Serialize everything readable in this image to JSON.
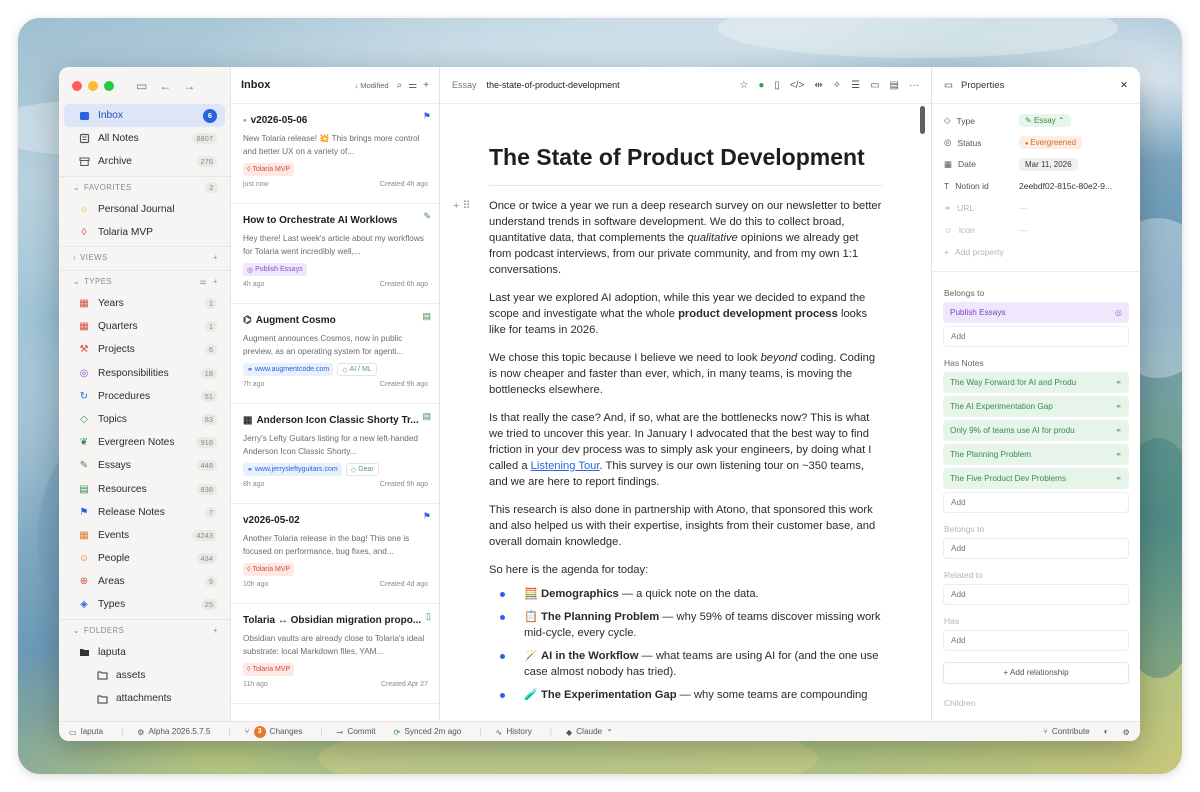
{
  "sidebar": {
    "items": [
      {
        "label": "Inbox",
        "count": "6",
        "icon": "inbox-icon",
        "color": "#2a63e0"
      },
      {
        "label": "All Notes",
        "count": "8807",
        "icon": "notes-icon",
        "color": "#555555"
      },
      {
        "label": "Archive",
        "count": "276",
        "icon": "archive-icon",
        "color": "#555555"
      }
    ],
    "favorites_label": "FAVORITES",
    "favorites_count": "2",
    "favorites": [
      {
        "label": "Personal Journal",
        "icon": "sun-icon",
        "color": "#e8a23a"
      },
      {
        "label": "Tolaria MVP",
        "icon": "drop-icon",
        "color": "#d34c3f"
      }
    ],
    "views_label": "VIEWS",
    "types_label": "TYPES",
    "types": [
      {
        "label": "Years",
        "count": "1",
        "icon": "calendar-icon",
        "color": "#d34c3f"
      },
      {
        "label": "Quarters",
        "count": "1",
        "icon": "calendar-icon",
        "color": "#d34c3f"
      },
      {
        "label": "Projects",
        "count": "6",
        "icon": "wrench-icon",
        "color": "#d34c3f"
      },
      {
        "label": "Responsibilities",
        "count": "18",
        "icon": "target-icon",
        "color": "#8a4fd0"
      },
      {
        "label": "Procedures",
        "count": "51",
        "icon": "cycle-icon",
        "color": "#2a63e0"
      },
      {
        "label": "Topics",
        "count": "83",
        "icon": "tag-icon",
        "color": "#3a8a4f"
      },
      {
        "label": "Evergreen Notes",
        "count": "916",
        "icon": "leaf-icon",
        "color": "#3a8a4f"
      },
      {
        "label": "Essays",
        "count": "448",
        "icon": "pen-icon",
        "color": "#3a8a4f"
      },
      {
        "label": "Resources",
        "count": "838",
        "icon": "book-icon",
        "color": "#3a8a4f"
      },
      {
        "label": "Release Notes",
        "count": "7",
        "icon": "flag-icon",
        "color": "#2a63e0"
      },
      {
        "label": "Events",
        "count": "4243",
        "icon": "calendar-icon",
        "color": "#e8782f"
      },
      {
        "label": "People",
        "count": "434",
        "icon": "people-icon",
        "color": "#e8782f"
      },
      {
        "label": "Areas",
        "count": "9",
        "icon": "globe-icon",
        "color": "#d34c3f"
      },
      {
        "label": "Types",
        "count": "25",
        "icon": "layers-icon",
        "color": "#2a63e0"
      }
    ],
    "folders_label": "FOLDERS",
    "folders": [
      {
        "label": "laputa",
        "icon": "folder-icon"
      },
      {
        "label": "assets",
        "icon": "folder-icon"
      },
      {
        "label": "attachments",
        "icon": "folder-icon"
      }
    ]
  },
  "notelist": {
    "title": "Inbox",
    "sort_label": "Modified",
    "notes": [
      {
        "title": "v2026-05-06",
        "snippet": "New Tolaria release! 💥 This brings more control and better UX on a variety of...",
        "tags": [
          {
            "label": "Tolaria MVP",
            "kind": "red"
          }
        ],
        "left_meta": "just now",
        "right_meta": "Created 4h ago",
        "flag": "⚑",
        "flag_color": "#2a63e0",
        "title_prefix": "●",
        "prefix_color": "#e8782f"
      },
      {
        "title": "How to Orchestrate AI Worklows",
        "snippet": "Hey there! Last week's article about my workflows for Tolaria went incredibly well,...",
        "tags": [
          {
            "label": "Publish Essays",
            "kind": "purple"
          }
        ],
        "left_meta": "4h ago",
        "right_meta": "Created 6h ago",
        "flag": "✎",
        "flag_color": "#3a8a4f",
        "title_prefix": "",
        "prefix_color": "#333333"
      },
      {
        "title": "Augment Cosmo",
        "snippet": "Augment announces Cosmos, now in public preview, as an operating system for agenti...",
        "tags": [
          {
            "label": "www.augmentcode.com",
            "kind": "blue"
          },
          {
            "label": "AI / ML",
            "kind": "gray"
          }
        ],
        "left_meta": "7h ago",
        "right_meta": "Created 9h ago",
        "flag": "▤",
        "flag_color": "#3a8a4f",
        "title_prefix": "⌬",
        "prefix_color": "#333333"
      },
      {
        "title": "Anderson Icon Classic Shorty Tr...",
        "snippet": "Jerry's Lefty Guitars listing for a new left-handed Anderson Icon Classic Shorty...",
        "tags": [
          {
            "label": "www.jerrysleftyguitars.com",
            "kind": "blue"
          },
          {
            "label": "Gear",
            "kind": "gray"
          }
        ],
        "left_meta": "8h ago",
        "right_meta": "Created 9h ago",
        "flag": "▤",
        "flag_color": "#3a8a4f",
        "title_prefix": "▦",
        "prefix_color": "#333333"
      },
      {
        "title": "v2026-05-02",
        "snippet": "Another Tolaria release in the bag! This one is focused on performance, bug fixes, and...",
        "tags": [
          {
            "label": "Tolaria MVP",
            "kind": "red"
          }
        ],
        "left_meta": "10h ago",
        "right_meta": "Created 4d ago",
        "flag": "⚑",
        "flag_color": "#2a63e0",
        "title_prefix": "",
        "prefix_color": "#333333"
      },
      {
        "title": "Tolaria ↔ Obsidian migration propo...",
        "snippet": "Obsidian vaults are already close to Tolaria's ideal substrate: local Markdown files, YAM...",
        "tags": [
          {
            "label": "Tolaria MVP",
            "kind": "red"
          }
        ],
        "left_meta": "11h ago",
        "right_meta": "Created Apr 27",
        "flag": "▯",
        "flag_color": "#3a8a4f",
        "title_prefix": "",
        "prefix_color": "#333333"
      }
    ]
  },
  "editor": {
    "crumb_type": "Essay",
    "crumb_file": "the-state-of-product-development",
    "title": "The State of Product Development",
    "p1_a": "Once or twice a year we run a deep research survey on our newsletter to better understand trends in software development. We do this to collect broad, quantitative data, that complements the ",
    "p1_em": "qualitative",
    "p1_b": " opinions we already get from podcast interviews, from our private community, and from my own 1:1 conversations.",
    "p2_a": "Last year we explored AI adoption, while this year we decided to expand the scope and investigate what the whole ",
    "p2_b": "product development process",
    "p2_c": " looks like for teams in 2026.",
    "p3_a": "We chose this topic because I believe we need to look ",
    "p3_em": "beyond",
    "p3_b": " coding. Coding is now cheaper and faster than ever, which, in many teams, is moving the bottlenecks elsewhere.",
    "p4_a": "Is that really the case? And, if so, what are the bottlenecks now? This is what we tried to uncover this year. In January I advocated that the best way to find friction in your dev process was to simply ask your engineers, by doing what I called a ",
    "p4_link": "Listening Tour",
    "p4_b": ". This survey is our own listening tour on ~350 teams, and we are here to report findings.",
    "p5": "This research is also done in partnership with Atono, that sponsored this work and also helped us with their expertise, insights from their customer base, and overall domain knowledge.",
    "p6": "So here is the agenda for today:",
    "agenda": [
      {
        "emoji": "🧮",
        "bold": "Demographics",
        "rest": " — a quick note on the data."
      },
      {
        "emoji": "📋",
        "bold": "The Planning Problem",
        "rest": " — why 59% of teams discover missing work mid-cycle, every cycle."
      },
      {
        "emoji": "🪄",
        "bold": "AI in the Workflow",
        "rest": " — what teams are using AI for (and the one use case almost nobody has tried)."
      },
      {
        "emoji": "🧪",
        "bold": "The Experimentation Gap",
        "rest": " — why some teams are compounding"
      }
    ]
  },
  "properties": {
    "title": "Properties",
    "rows": [
      {
        "key": "Type",
        "value": "Essay",
        "kind": "green",
        "icon": "type-icon"
      },
      {
        "key": "Status",
        "value": "Evergreened",
        "kind": "orange",
        "icon": "status-icon"
      },
      {
        "key": "Date",
        "value": "Mar 11, 2026",
        "kind": "gray",
        "icon": "calendar-icon"
      },
      {
        "key": "Notion id",
        "value": "2eebdf02-815c-80e2-9...",
        "kind": "plain",
        "icon": "text-icon"
      },
      {
        "key": "URL",
        "value": "—",
        "kind": "dim",
        "icon": "link-icon"
      },
      {
        "key": "Icon",
        "value": "—",
        "kind": "dim",
        "icon": "icon-icon"
      }
    ],
    "add_property": "Add property",
    "belongs_to_label": "Belongs to",
    "belongs_to": [
      "Publish Essays"
    ],
    "has_notes_label": "Has Notes",
    "has_notes": [
      "The Way Forward for AI and Produ",
      "The AI Experimentation Gap",
      "Only 9% of teams use AI for produ",
      "The Planning Problem",
      "The Five Product Dev Problems"
    ],
    "add_label": "Add",
    "belongs_to2_label": "Belongs to",
    "related_to_label": "Related to",
    "has_label": "Has",
    "add_relationship": "+ Add relationship",
    "children_label": "Children"
  },
  "statusbar": {
    "vault": "laputa",
    "version": "Alpha 2026.5.7.5",
    "changes_count": "3",
    "changes": "Changes",
    "commit": "Commit",
    "synced": "Synced 2m ago",
    "history": "History",
    "ai": "Claude",
    "contribute": "Contribute"
  }
}
